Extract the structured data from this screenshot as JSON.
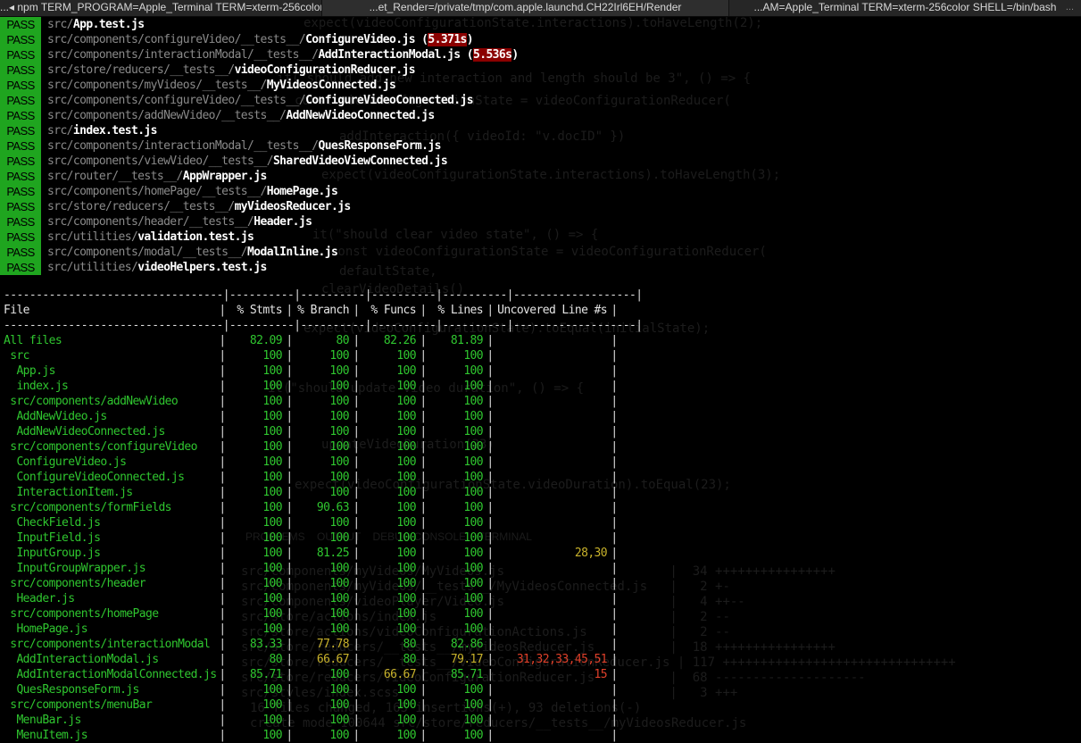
{
  "tabs": [
    {
      "label": "...◂ npm TERM_PROGRAM=Apple_Terminal TERM=xterm-256color",
      "active": false
    },
    {
      "label": "...et_Render=/private/tmp/com.apple.launchd.CH22Irl6EH/Render",
      "active": true
    },
    {
      "label": "...AM=Apple_Terminal TERM=xterm-256color SHELL=/bin/bash",
      "active": false
    }
  ],
  "tab_overflow": "...",
  "pass_label": "PASS",
  "tests": [
    {
      "dir": "src/",
      "file": "App.test.js",
      "time": ""
    },
    {
      "dir": "src/components/configureVideo/__tests__/",
      "file": "ConfigureVideo.js",
      "time": "5.371s"
    },
    {
      "dir": "src/components/interactionModal/__tests__/",
      "file": "AddInteractionModal.js",
      "time": "5.536s"
    },
    {
      "dir": "src/store/reducers/__tests__/",
      "file": "videoConfigurationReducer.js",
      "time": ""
    },
    {
      "dir": "src/components/myVideos/__tests__/",
      "file": "MyVideosConnected.js",
      "time": ""
    },
    {
      "dir": "src/components/configureVideo/__tests__/",
      "file": "ConfigureVideoConnected.js",
      "time": ""
    },
    {
      "dir": "src/components/addNewVideo/__tests__/",
      "file": "AddNewVideoConnected.js",
      "time": ""
    },
    {
      "dir": "src/",
      "file": "index.test.js",
      "time": ""
    },
    {
      "dir": "src/components/interactionModal/__tests__/",
      "file": "QuesResponseForm.js",
      "time": ""
    },
    {
      "dir": "src/components/viewVideo/__tests__/",
      "file": "SharedVideoViewConnected.js",
      "time": ""
    },
    {
      "dir": "src/router/__tests__/",
      "file": "AppWrapper.js",
      "time": ""
    },
    {
      "dir": "src/components/homePage/__tests__/",
      "file": "HomePage.js",
      "time": ""
    },
    {
      "dir": "src/store/reducers/__tests__/",
      "file": "myVideosReducer.js",
      "time": ""
    },
    {
      "dir": "src/components/header/__tests__/",
      "file": "Header.js",
      "time": ""
    },
    {
      "dir": "src/utilities/",
      "file": "validation.test.js",
      "time": ""
    },
    {
      "dir": "src/components/modal/__tests__/",
      "file": "ModalInline.js",
      "time": ""
    },
    {
      "dir": "src/utilities/",
      "file": "videoHelpers.test.js",
      "time": ""
    }
  ],
  "coverage": {
    "headers": [
      "File",
      "% Stmts",
      "% Branch",
      "% Funcs",
      "% Lines",
      "Uncovered Line #s"
    ],
    "colors": {
      "high": "#2fc62f",
      "medium": "#c8b22b",
      "low": "#e0402a"
    },
    "rows": [
      {
        "file": "All files",
        "indent": 0,
        "stmts": "82.09",
        "branch": "80",
        "funcs": "82.26",
        "lines": "81.89",
        "uncovered": "",
        "c": [
          "green",
          "green",
          "green",
          "green",
          ""
        ]
      },
      {
        "file": "src",
        "indent": 1,
        "stmts": "100",
        "branch": "100",
        "funcs": "100",
        "lines": "100",
        "uncovered": "",
        "c": [
          "green",
          "green",
          "green",
          "green",
          ""
        ]
      },
      {
        "file": "App.js",
        "indent": 2,
        "stmts": "100",
        "branch": "100",
        "funcs": "100",
        "lines": "100",
        "uncovered": "",
        "c": [
          "green",
          "green",
          "green",
          "green",
          ""
        ]
      },
      {
        "file": "index.js",
        "indent": 2,
        "stmts": "100",
        "branch": "100",
        "funcs": "100",
        "lines": "100",
        "uncovered": "",
        "c": [
          "green",
          "green",
          "green",
          "green",
          ""
        ]
      },
      {
        "file": "src/components/addNewVideo",
        "indent": 1,
        "stmts": "100",
        "branch": "100",
        "funcs": "100",
        "lines": "100",
        "uncovered": "",
        "c": [
          "green",
          "green",
          "green",
          "green",
          ""
        ]
      },
      {
        "file": "AddNewVideo.js",
        "indent": 2,
        "stmts": "100",
        "branch": "100",
        "funcs": "100",
        "lines": "100",
        "uncovered": "",
        "c": [
          "green",
          "green",
          "green",
          "green",
          ""
        ]
      },
      {
        "file": "AddNewVideoConnected.js",
        "indent": 2,
        "stmts": "100",
        "branch": "100",
        "funcs": "100",
        "lines": "100",
        "uncovered": "",
        "c": [
          "green",
          "green",
          "green",
          "green",
          ""
        ]
      },
      {
        "file": "src/components/configureVideo",
        "indent": 1,
        "stmts": "100",
        "branch": "100",
        "funcs": "100",
        "lines": "100",
        "uncovered": "",
        "c": [
          "green",
          "green",
          "green",
          "green",
          ""
        ]
      },
      {
        "file": "ConfigureVideo.js",
        "indent": 2,
        "stmts": "100",
        "branch": "100",
        "funcs": "100",
        "lines": "100",
        "uncovered": "",
        "c": [
          "green",
          "green",
          "green",
          "green",
          ""
        ]
      },
      {
        "file": "ConfigureVideoConnected.js",
        "indent": 2,
        "stmts": "100",
        "branch": "100",
        "funcs": "100",
        "lines": "100",
        "uncovered": "",
        "c": [
          "green",
          "green",
          "green",
          "green",
          ""
        ]
      },
      {
        "file": "InteractionItem.js",
        "indent": 2,
        "stmts": "100",
        "branch": "100",
        "funcs": "100",
        "lines": "100",
        "uncovered": "",
        "c": [
          "green",
          "green",
          "green",
          "green",
          ""
        ]
      },
      {
        "file": "src/components/formFields",
        "indent": 1,
        "stmts": "100",
        "branch": "90.63",
        "funcs": "100",
        "lines": "100",
        "uncovered": "",
        "c": [
          "green",
          "green",
          "green",
          "green",
          ""
        ]
      },
      {
        "file": "CheckField.js",
        "indent": 2,
        "stmts": "100",
        "branch": "100",
        "funcs": "100",
        "lines": "100",
        "uncovered": "",
        "c": [
          "green",
          "green",
          "green",
          "green",
          ""
        ]
      },
      {
        "file": "InputField.js",
        "indent": 2,
        "stmts": "100",
        "branch": "100",
        "funcs": "100",
        "lines": "100",
        "uncovered": "",
        "c": [
          "green",
          "green",
          "green",
          "green",
          ""
        ]
      },
      {
        "file": "InputGroup.js",
        "indent": 2,
        "stmts": "100",
        "branch": "81.25",
        "funcs": "100",
        "lines": "100",
        "uncovered": "28,30",
        "c": [
          "green",
          "green",
          "green",
          "green",
          "yellow"
        ]
      },
      {
        "file": "InputGroupWrapper.js",
        "indent": 2,
        "stmts": "100",
        "branch": "100",
        "funcs": "100",
        "lines": "100",
        "uncovered": "",
        "c": [
          "green",
          "green",
          "green",
          "green",
          ""
        ]
      },
      {
        "file": "src/components/header",
        "indent": 1,
        "stmts": "100",
        "branch": "100",
        "funcs": "100",
        "lines": "100",
        "uncovered": "",
        "c": [
          "green",
          "green",
          "green",
          "green",
          ""
        ]
      },
      {
        "file": "Header.js",
        "indent": 2,
        "stmts": "100",
        "branch": "100",
        "funcs": "100",
        "lines": "100",
        "uncovered": "",
        "c": [
          "green",
          "green",
          "green",
          "green",
          ""
        ]
      },
      {
        "file": "src/components/homePage",
        "indent": 1,
        "stmts": "100",
        "branch": "100",
        "funcs": "100",
        "lines": "100",
        "uncovered": "",
        "c": [
          "green",
          "green",
          "green",
          "green",
          ""
        ]
      },
      {
        "file": "HomePage.js",
        "indent": 2,
        "stmts": "100",
        "branch": "100",
        "funcs": "100",
        "lines": "100",
        "uncovered": "",
        "c": [
          "green",
          "green",
          "green",
          "green",
          ""
        ]
      },
      {
        "file": "src/components/interactionModal",
        "indent": 1,
        "stmts": "83.33",
        "branch": "77.78",
        "funcs": "80",
        "lines": "82.86",
        "uncovered": "",
        "c": [
          "green",
          "yellow",
          "green",
          "green",
          ""
        ]
      },
      {
        "file": "AddInteractionModal.js",
        "indent": 2,
        "stmts": "80",
        "branch": "66.67",
        "funcs": "80",
        "lines": "79.17",
        "uncovered": "31,32,33,45,51",
        "c": [
          "green",
          "yellow",
          "green",
          "yellow",
          "red"
        ]
      },
      {
        "file": "AddInteractionModalConnected.js",
        "indent": 2,
        "stmts": "85.71",
        "branch": "100",
        "funcs": "66.67",
        "lines": "85.71",
        "uncovered": "15",
        "c": [
          "green",
          "green",
          "yellow",
          "green",
          "red"
        ]
      },
      {
        "file": "QuesResponseForm.js",
        "indent": 2,
        "stmts": "100",
        "branch": "100",
        "funcs": "100",
        "lines": "100",
        "uncovered": "",
        "c": [
          "green",
          "green",
          "green",
          "green",
          ""
        ]
      },
      {
        "file": "src/components/menuBar",
        "indent": 1,
        "stmts": "100",
        "branch": "100",
        "funcs": "100",
        "lines": "100",
        "uncovered": "",
        "c": [
          "green",
          "green",
          "green",
          "green",
          ""
        ]
      },
      {
        "file": "MenuBar.js",
        "indent": 2,
        "stmts": "100",
        "branch": "100",
        "funcs": "100",
        "lines": "100",
        "uncovered": "",
        "c": [
          "green",
          "green",
          "green",
          "green",
          ""
        ]
      },
      {
        "file": "MenuItem.js",
        "indent": 2,
        "stmts": "100",
        "branch": "100",
        "funcs": "100",
        "lines": "100",
        "uncovered": "",
        "c": [
          "green",
          "green",
          "green",
          "green",
          ""
        ]
      }
    ]
  },
  "ghost_overlay": [
    "expect(videoConfigurationState.interactions).toHaveLength(2);",
    "it(\"should add new interaction and length should be 3\", () => {",
    "const videoConfigurationState = videoConfigurationReducer(",
    "addInteraction({ videoId: \"v.docID\" })",
    "expect(videoConfigurationState.interactions).toHaveLength(3);",
    "it(\"should clear video state\", () => {",
    "const videoConfigurationState = videoConfigurationReducer(",
    "defaultState,",
    "clearVideoDetails()",
    "expect(videoConfigurationState).toEqual(initialState);",
    "it(\"should update video duration\", () => {",
    "updateVideoDuration(23)",
    "expect(videoConfigurationState.videoDuration).toEqual(23);",
    "PROBLEMS    OUTPUT    DEBUG CONSOLE    TERMINAL",
    "src/components/myVideos/MyVideos.js                      |  34 ++++++++++++++++",
    "src/components/myVideos/__tests__/MyVideosConnected.js   |   2 +-",
    "src/components/videoPlayer/Video.js                      |   4 ++--",
    "src/store/actions/index.js                               |   2 --",
    "src/store/actions/videoConfigurationActions.js           |   2 --",
    "src/store/reducers/__tests__/myVideosReducer.js          |  18 ++++++++++++++++",
    "src/store/reducers/__tests__/videoConfigurationReducer.js | 117 +++++++++++++++++++++++++++++++",
    "src/store/reducers/videoConfigurationReducer.js          |  68 --------------------",
    "src/styles/index.scss                                    |   3 +++",
    "16 files changed, 165 insertions(+), 93 deletions(-)",
    "create mode 100644 src/store/reducers/__tests__/myVideosReducer.js"
  ]
}
